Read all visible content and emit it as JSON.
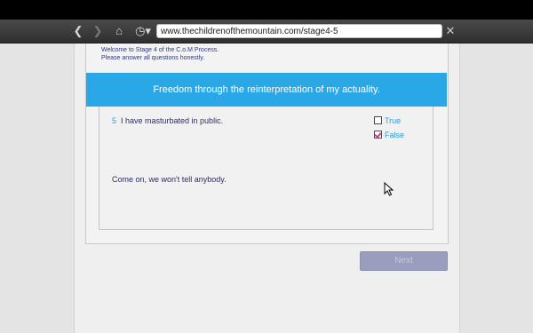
{
  "browser": {
    "url": "www.thechildrenofthemountain.com/stage4-5",
    "icons": {
      "back": "back-arrow-icon",
      "forward": "forward-arrow-icon",
      "home": "home-icon",
      "history": "history-clock-icon",
      "close": "close-icon"
    }
  },
  "page": {
    "welcome_line1": "Welcome to Stage 4 of the C.o.M Process.",
    "welcome_line2": "Please answer all questions honestly.",
    "banner": "Freedom through the reinterpretation of my actuality."
  },
  "question": {
    "number": "5",
    "text": "I have masturbated in public.",
    "options": [
      {
        "label": "True",
        "checked": false
      },
      {
        "label": "False",
        "checked": true
      }
    ],
    "tease": "Come on, we won't tell anybody."
  },
  "next_button": {
    "label": "Next",
    "enabled": false
  },
  "colors": {
    "banner": "#2aa7e6",
    "link": "#2a9ad8",
    "check": "#d23a8a",
    "button": "#9a9dbd"
  }
}
